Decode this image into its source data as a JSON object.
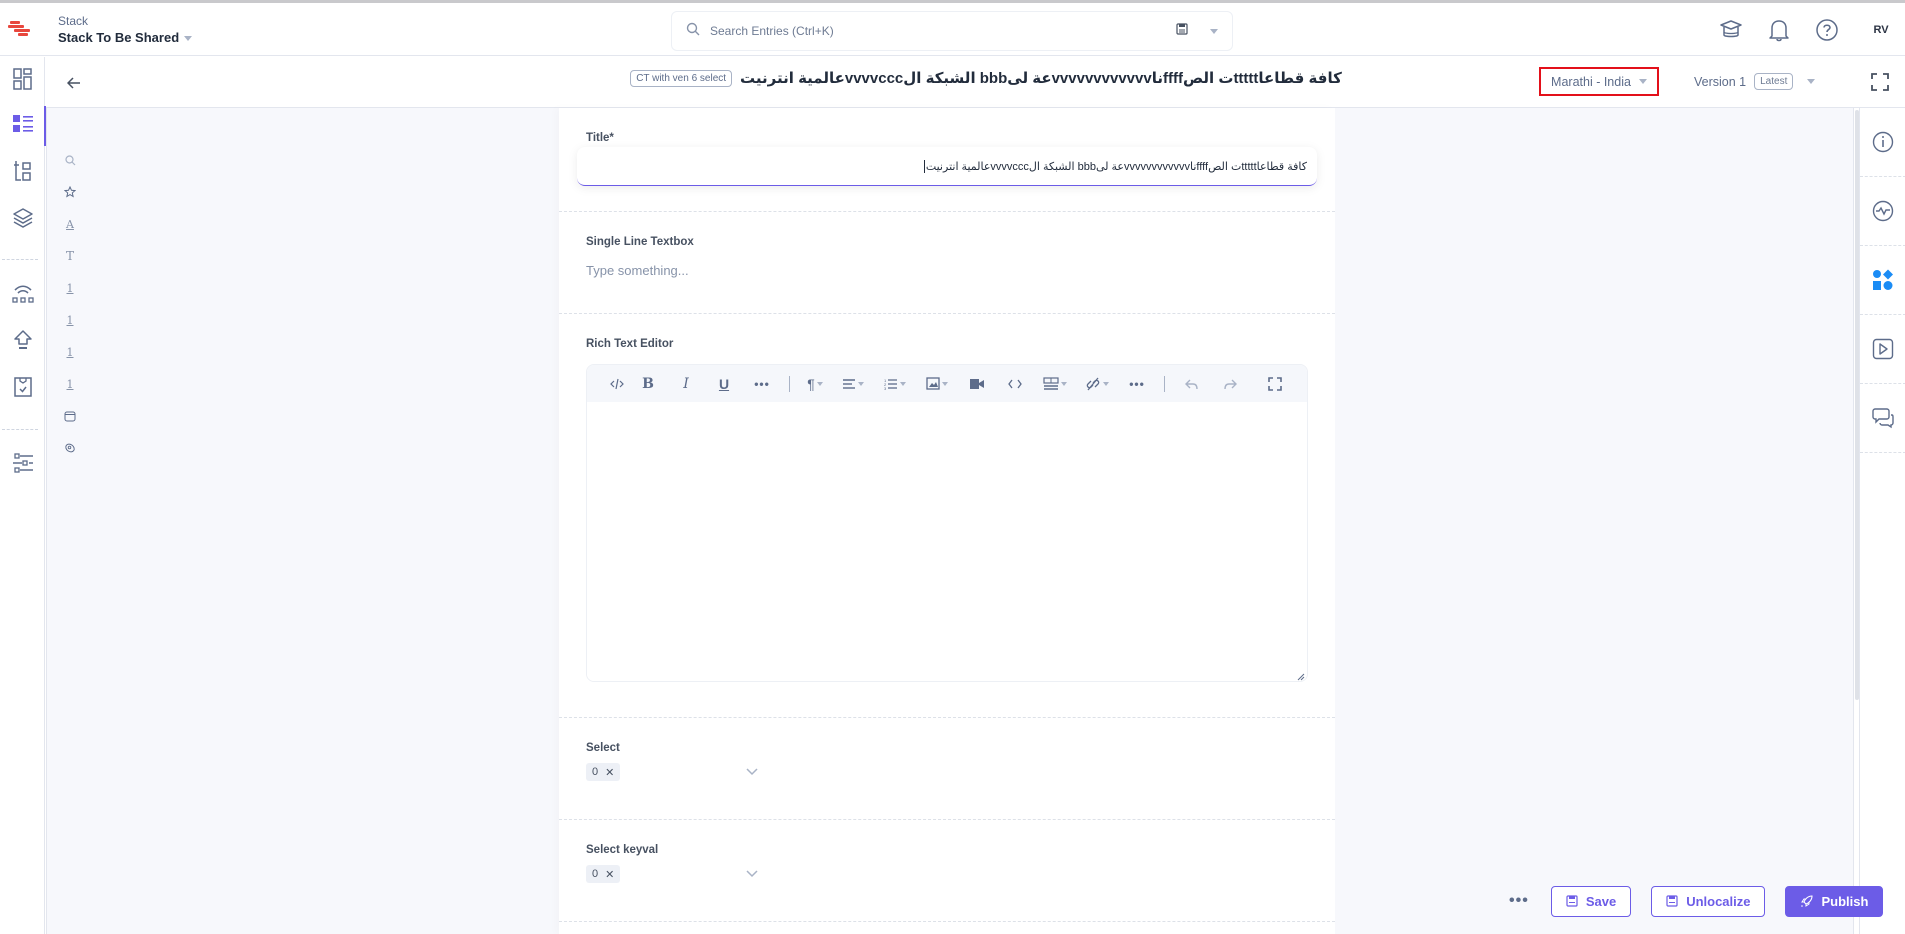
{
  "header": {
    "stack_label": "Stack",
    "stack_name": "Stack To Be Shared",
    "search_placeholder": "Search Entries (Ctrl+K)",
    "avatar_initials": "RV"
  },
  "left_rail": {
    "items": [
      {
        "icon": "dashboard-icon"
      },
      {
        "icon": "entries-icon",
        "active": true
      },
      {
        "icon": "content-models-icon"
      },
      {
        "icon": "assets-icon"
      },
      {
        "icon": "releases-icon"
      },
      {
        "icon": "publish-queue-icon"
      },
      {
        "icon": "tasks-icon"
      },
      {
        "icon": "settings-icon"
      }
    ]
  },
  "subheader": {
    "entry_title": "كافة قطاعاtttttت الصffffناvvvvvvvvvvvvعة لىbbb الشبكة الvvvvcccعالمية انترنيت",
    "content_type_badge": "CT with ven 6 select",
    "locale": "Marathi - India",
    "version_label": "Version 1",
    "version_badge": "Latest"
  },
  "outline": {
    "items": [
      {
        "icon": "search-icon"
      },
      {
        "icon": "star-icon"
      },
      {
        "icon": "title-field-icon",
        "glyph": "A"
      },
      {
        "icon": "text-field-icon",
        "glyph": "T"
      },
      {
        "icon": "number-field-icon",
        "glyph": "1"
      },
      {
        "icon": "number-field-icon",
        "glyph": "1"
      },
      {
        "icon": "number-field-icon",
        "glyph": "1"
      },
      {
        "icon": "number-field-icon",
        "glyph": "1"
      },
      {
        "icon": "group-field-icon"
      },
      {
        "icon": "tag-field-icon"
      }
    ]
  },
  "form": {
    "title": {
      "label": "Title*",
      "value": "كافة قطاعاtttttت الصffffناvvvvvvvvvvvvعة لىbbb الشبكة الvvvvcccعالمية انترنيت"
    },
    "single_line": {
      "label": "Single Line Textbox",
      "placeholder": "Type something..."
    },
    "rich_text": {
      "label": "Rich Text Editor",
      "toolbar": [
        "source-code",
        "bold",
        "italic",
        "underline",
        "more",
        "paragraph",
        "align",
        "list",
        "image",
        "video",
        "code",
        "table",
        "link",
        "more",
        "undo",
        "redo",
        "fullscreen"
      ]
    },
    "select": {
      "label": "Select",
      "chip": "0"
    },
    "select_keyval": {
      "label": "Select keyval",
      "chip": "0"
    }
  },
  "right_rail": {
    "items": [
      {
        "icon": "info-icon"
      },
      {
        "icon": "activity-icon"
      },
      {
        "icon": "extensions-icon",
        "active": true
      },
      {
        "icon": "preview-icon"
      },
      {
        "icon": "comments-icon"
      }
    ]
  },
  "actions": {
    "save": "Save",
    "unlocalize": "Unlocalize",
    "publish": "Publish"
  },
  "colors": {
    "accent": "#6c5ce7",
    "locale_highlight": "#e3101a",
    "extension_active": "#1b8cf5",
    "logo": "#e8473d"
  }
}
